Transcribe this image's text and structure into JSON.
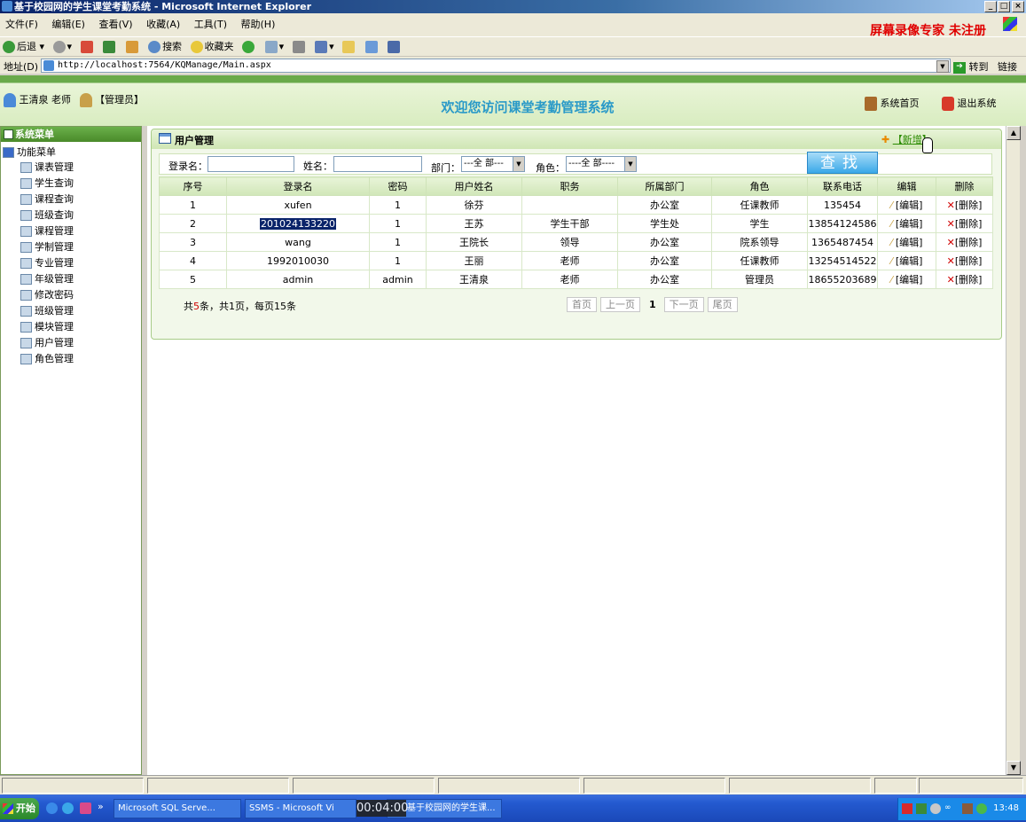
{
  "window": {
    "title": "基于校园网的学生课堂考勤系统 - Microsoft Internet Explorer",
    "min": "_",
    "max": "□",
    "close": "×"
  },
  "menubar": {
    "items": [
      "文件(F)",
      "编辑(E)",
      "查看(V)",
      "收藏(A)",
      "工具(T)",
      "帮助(H)"
    ],
    "watermark": "屏幕录像专家 未注册"
  },
  "toolbar": {
    "back": "后退",
    "search": "搜索",
    "favorites": "收藏夹"
  },
  "address": {
    "label": "地址(D)",
    "url": "http://localhost:7564/KQManage/Main.aspx",
    "go": "转到",
    "links": "链接"
  },
  "header": {
    "user_name": "王清泉 老师",
    "role": "【管理员】",
    "title": "欢迎您访问课堂考勤管理系统",
    "home": "系统首页",
    "logout": "退出系统"
  },
  "sidebar": {
    "title": "系统菜单",
    "root": "功能菜单",
    "items": [
      "课表管理",
      "学生查询",
      "课程查询",
      "班级查询",
      "课程管理",
      "学制管理",
      "专业管理",
      "年级管理",
      "修改密码",
      "班级管理",
      "模块管理",
      "用户管理",
      "角色管理"
    ]
  },
  "panel": {
    "title": "用户管理",
    "add": "【新增】"
  },
  "filter": {
    "login_label": "登录名：",
    "name_label": "姓名：",
    "dept_label": "部门：",
    "dept_value": "---全 部---",
    "role_label": "角色：",
    "role_value": "----全 部----",
    "search": "查找"
  },
  "table": {
    "headers": [
      "序号",
      "登录名",
      "密码",
      "用户姓名",
      "职务",
      "所属部门",
      "角色",
      "联系电话",
      "编辑",
      "删除"
    ],
    "edit_label": "[编辑]",
    "delete_label": "[删除]",
    "rows": [
      [
        "1",
        "xufen",
        "1",
        "徐芬",
        "",
        "办公室",
        "任课教师",
        "135454"
      ],
      [
        "2",
        "201024133220",
        "1",
        "王苏",
        "学生干部",
        "学生处",
        "学生",
        "13854124586"
      ],
      [
        "3",
        "wang",
        "1",
        "王院长",
        "领导",
        "办公室",
        "院系领导",
        "1365487454"
      ],
      [
        "4",
        "1992010030",
        "1",
        "王丽",
        "老师",
        "办公室",
        "任课教师",
        "13254514522"
      ],
      [
        "5",
        "admin",
        "admin",
        "王清泉",
        "老师",
        "办公室",
        "管理员",
        "18655203689"
      ]
    ]
  },
  "pager": {
    "info_prefix": "共",
    "count": "5",
    "info_suffix": "条，共1页，每页15条",
    "first": "首页",
    "prev": "上一页",
    "current": "1",
    "next": "下一页",
    "last": "尾页"
  },
  "taskbar": {
    "start": "开始",
    "task1": "Microsoft SQL Serve...",
    "task2": "SSMS - Microsoft Vi",
    "task3": "基于校园网的学生课...",
    "timer": "00:04:00",
    "clock": "13:48"
  }
}
